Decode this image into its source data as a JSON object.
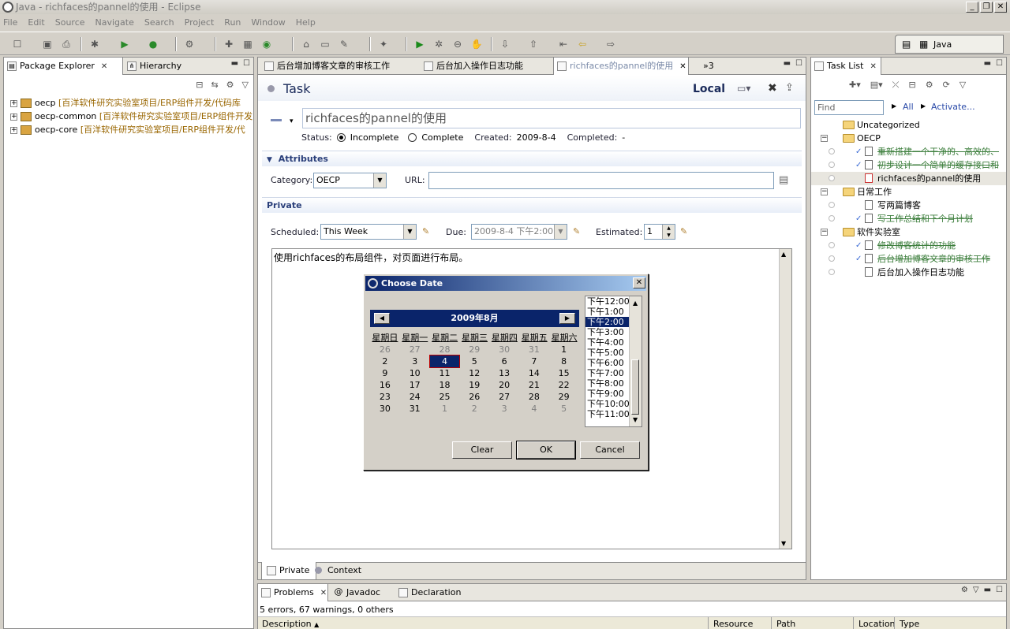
{
  "window": {
    "title": "Java - richfaces的pannel的使用 - Eclipse"
  },
  "menu": [
    "File",
    "Edit",
    "Source",
    "Navigate",
    "Search",
    "Project",
    "Run",
    "Window",
    "Help"
  ],
  "perspective": {
    "label": "Java"
  },
  "package_explorer": {
    "tabs": [
      {
        "label": "Package Explorer"
      },
      {
        "label": "Hierarchy"
      }
    ],
    "items": [
      {
        "name": "oecp",
        "detail": "[百洋软件研究实验室项目/ERP组件开发/代码库"
      },
      {
        "name": "oecp-common",
        "detail": "[百洋软件研究实验室项目/ERP组件开发"
      },
      {
        "name": "oecp-core",
        "detail": "[百洋软件研究实验室项目/ERP组件开发/代"
      }
    ]
  },
  "editor": {
    "tabs": [
      {
        "label": "后台增加博客文章的审核工作"
      },
      {
        "label": "后台加入操作日志功能"
      },
      {
        "label": "richfaces的pannel的使用"
      }
    ],
    "overflow": "»3",
    "header": {
      "title": "Task",
      "scope": "Local"
    },
    "summary": "richfaces的pannel的使用",
    "status": {
      "label": "Status:",
      "incomplete": "Incomplete",
      "complete": "Complete",
      "created_label": "Created:",
      "created": "2009-8-4",
      "completed_label": "Completed:",
      "completed": "-"
    },
    "attributes": {
      "title": "Attributes",
      "category_label": "Category:",
      "category": "OECP",
      "url_label": "URL:",
      "url": ""
    },
    "private": {
      "title": "Private",
      "scheduled_label": "Scheduled:",
      "scheduled": "This Week",
      "due_label": "Due:",
      "due": "2009-8-4 下午2:00",
      "estimated_label": "Estimated:",
      "estimated": "1"
    },
    "notes": "使用richfaces的布局组件，对页面进行布局。",
    "bottom_tabs": [
      {
        "label": "Private"
      },
      {
        "label": "Context"
      }
    ]
  },
  "date_dialog": {
    "title": "Choose Date",
    "month": "2009年8月",
    "weekdays": [
      "星期日",
      "星期一",
      "星期二",
      "星期三",
      "星期四",
      "星期五",
      "星期六"
    ],
    "days": [
      {
        "d": "26",
        "other": true
      },
      {
        "d": "27",
        "other": true
      },
      {
        "d": "28",
        "other": true
      },
      {
        "d": "29",
        "other": true
      },
      {
        "d": "30",
        "other": true
      },
      {
        "d": "31",
        "other": true
      },
      {
        "d": "1"
      },
      {
        "d": "2"
      },
      {
        "d": "3"
      },
      {
        "d": "4",
        "sel": true
      },
      {
        "d": "5"
      },
      {
        "d": "6"
      },
      {
        "d": "7"
      },
      {
        "d": "8"
      },
      {
        "d": "9"
      },
      {
        "d": "10"
      },
      {
        "d": "11"
      },
      {
        "d": "12"
      },
      {
        "d": "13"
      },
      {
        "d": "14"
      },
      {
        "d": "15"
      },
      {
        "d": "16"
      },
      {
        "d": "17"
      },
      {
        "d": "18"
      },
      {
        "d": "19"
      },
      {
        "d": "20"
      },
      {
        "d": "21"
      },
      {
        "d": "22"
      },
      {
        "d": "23"
      },
      {
        "d": "24"
      },
      {
        "d": "25"
      },
      {
        "d": "26"
      },
      {
        "d": "27"
      },
      {
        "d": "28"
      },
      {
        "d": "29"
      },
      {
        "d": "30"
      },
      {
        "d": "31"
      },
      {
        "d": "1",
        "other": true
      },
      {
        "d": "2",
        "other": true
      },
      {
        "d": "3",
        "other": true
      },
      {
        "d": "4",
        "other": true
      },
      {
        "d": "5",
        "other": true
      }
    ],
    "times": [
      "下午12:00",
      "下午1:00",
      "下午2:00",
      "下午3:00",
      "下午4:00",
      "下午5:00",
      "下午6:00",
      "下午7:00",
      "下午8:00",
      "下午9:00",
      "下午10:00",
      "下午11:00"
    ],
    "selected_time": "下午2:00",
    "buttons": {
      "clear": "Clear",
      "ok": "OK",
      "cancel": "Cancel"
    }
  },
  "task_list": {
    "tab": "Task List",
    "find_placeholder": "Find",
    "all": "All",
    "activate": "Activate...",
    "items": [
      {
        "label": "Uncategorized",
        "level": 0,
        "type": "folder"
      },
      {
        "label": "OECP",
        "level": 0,
        "type": "folder",
        "expand": "−"
      },
      {
        "label": "重新搭建一个干净的、高效的、",
        "level": 1,
        "type": "task",
        "done": true
      },
      {
        "label": "初步设计一个简单的缓存接口和",
        "level": 1,
        "type": "task",
        "done": true
      },
      {
        "label": "richfaces的pannel的使用",
        "level": 1,
        "type": "task",
        "active": true
      },
      {
        "label": "日常工作",
        "level": 0,
        "type": "folder",
        "expand": "−"
      },
      {
        "label": "写两篇博客",
        "level": 1,
        "type": "task"
      },
      {
        "label": "写工作总结和下个月计划",
        "level": 1,
        "type": "task",
        "done": true
      },
      {
        "label": "软件实验室",
        "level": 0,
        "type": "folder",
        "expand": "−"
      },
      {
        "label": "修改博客统计的功能",
        "level": 1,
        "type": "task",
        "done": true
      },
      {
        "label": "后台增加博客文章的审核工作",
        "level": 1,
        "type": "task",
        "done": true
      },
      {
        "label": "后台加入操作日志功能",
        "level": 1,
        "type": "task"
      }
    ]
  },
  "problems": {
    "tabs": [
      {
        "label": "Problems"
      },
      {
        "label": "Javadoc"
      },
      {
        "label": "Declaration"
      }
    ],
    "summary": "5 errors, 67 warnings, 0 others",
    "columns": [
      "Description",
      "Resource",
      "Path",
      "Location",
      "Type"
    ]
  }
}
